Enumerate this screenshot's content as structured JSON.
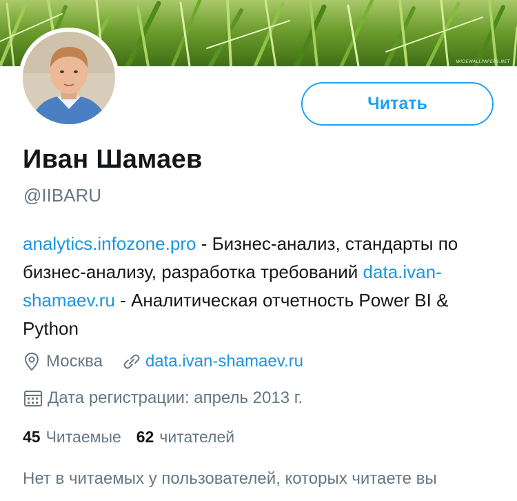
{
  "banner": {
    "watermark": "WIDEWALLPAPERS.NET"
  },
  "profile": {
    "name": "Иван Шамаев",
    "handle": "@IIBARU",
    "follow_label": "Читать"
  },
  "bio": {
    "link1": "analytics.infozone.pro",
    "text1": " - Бизнес-анализ, стандарты по бизнес-анализу, разработка требований ",
    "link2": "data.ivan-shamaev.ru",
    "text2": " - Аналитическая отчетность Power BI & Python"
  },
  "meta": {
    "location": "Москва",
    "website": "data.ivan-shamaev.ru",
    "joined": "Дата регистрации: апрель 2013 г."
  },
  "stats": {
    "following_count": "45",
    "following_label": "Читаемые",
    "followers_count": "62",
    "followers_label": "читателей"
  },
  "followers_you_know": "Нет в читаемых у пользователей, которых читаете вы",
  "colors": {
    "accent": "#1da1f2",
    "link": "#1b95e0",
    "secondary_text": "#657786",
    "primary_text": "#14171a"
  },
  "icons": [
    "location-pin-icon",
    "link-icon",
    "calendar-icon"
  ]
}
